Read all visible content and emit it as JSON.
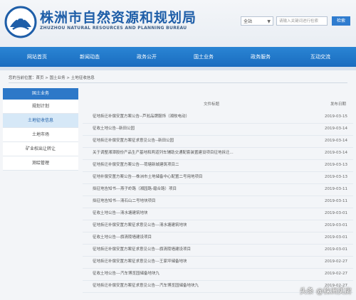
{
  "site": {
    "title_cn": "株洲市自然资源和规划局",
    "title_en": "ZHUZHOU NATURAL RESOURCES AND PLANNING BUREAU"
  },
  "search": {
    "select_value": "全站",
    "placeholder": "请输入关键词进行检索",
    "button_label": "检索"
  },
  "nav": {
    "items": [
      "网站首页",
      "新闻动态",
      "政务公开",
      "国土业务",
      "政务服务",
      "互动交流"
    ]
  },
  "breadcrumb": "您的当前位置：首页 > 国土业务 > 土地征收信息",
  "sidebar": {
    "heading": "国土业务",
    "items": [
      "规划计划",
      "土地征收信息",
      "土地市场",
      "矿业权出让转让",
      "测绘管理"
    ]
  },
  "table": {
    "col_title": "文件标题",
    "col_date": "发布日期",
    "rows": [
      {
        "title": "征地拆迁补偿安置方案公告--芦淞品牌服饰（湘攸电动）",
        "date": "2019-03-15"
      },
      {
        "title": "征收土地公告--新田公园",
        "date": "2019-03-14"
      },
      {
        "title": "征地拆迁补偿安置方案征求意见公告--新田公园",
        "date": "2019-03-14"
      },
      {
        "title": "关于调整湘潭股份产品生产基地和两道列车辅助交通配套装置建设项目征地拆迁...",
        "date": "2019-03-14"
      },
      {
        "title": "征地拆迁补偿安置方案公告---荷塘新城建筑项目二",
        "date": "2019-03-13"
      },
      {
        "title": "征地补偿安置方案公告---株洲市土地储备中心配置二号用地项目",
        "date": "2019-03-13"
      },
      {
        "title": "拟征地告知书---燕子岭路（湘园路-磨合路）项目",
        "date": "2019-03-11"
      },
      {
        "title": "拟征地告知书---清石山二号地块项目",
        "date": "2019-03-11"
      },
      {
        "title": "征收土地公告---清水塘建筑地块",
        "date": "2019-03-01"
      },
      {
        "title": "征地拆迁补偿安置方案征求意见公告---清水塘建筑地块",
        "date": "2019-03-01"
      },
      {
        "title": "征收土地公告---旗清陵墙建设项目",
        "date": "2019-03-01"
      },
      {
        "title": "征地拆迁补偿安置方案征求意见公告---旗清陵墙建设项目",
        "date": "2019-03-01"
      },
      {
        "title": "征地拆迁补偿安置方案征求意见公告---王家坪储备地块",
        "date": "2019-02-27"
      },
      {
        "title": "征收土地公告---汽车博览园储备地块九",
        "date": "2019-02-27"
      },
      {
        "title": "征地拆迁补偿安置方案征求意见公告---汽车博览园储备地块九",
        "date": "2019-02-27"
      }
    ]
  },
  "watermark": "头条 @株洲买房"
}
